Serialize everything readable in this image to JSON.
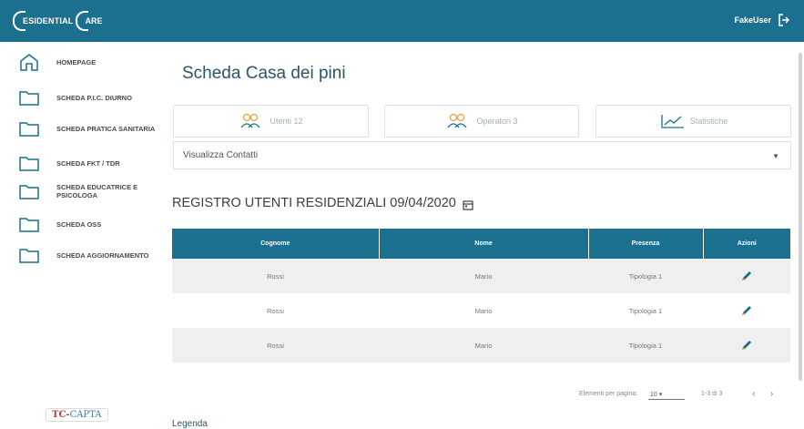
{
  "header": {
    "brand_part1": "ESIDENTIAL",
    "brand_part2": "ARE",
    "user": "FakeUser"
  },
  "sidebar": {
    "items": [
      {
        "label": "HOMEPAGE",
        "icon": "home-icon"
      },
      {
        "label": "SCHEDA P.I.C. DIURNO",
        "icon": "folder-icon"
      },
      {
        "label": "SCHEDA PRATICA SANITARIA",
        "icon": "folder-icon"
      },
      {
        "label": "SCHEDA FKT / TDR",
        "icon": "folder-icon"
      },
      {
        "label": "SCHEDA EDUCATRICE E PSICOLOGA",
        "icon": "folder-icon"
      },
      {
        "label": "SCHEDA OSS",
        "icon": "folder-icon"
      },
      {
        "label": "SCHEDA AGGIORNAMENTO",
        "icon": "folder-icon"
      }
    ],
    "logo_text_a": "TC-",
    "logo_text_b": "CAPTA"
  },
  "main": {
    "title": "Scheda Casa dei pini",
    "cards": [
      {
        "label": "Utenti 12",
        "icon": "users-icon"
      },
      {
        "label": "Operatori 3",
        "icon": "operators-icon"
      },
      {
        "label": "Statistiche",
        "icon": "chart-icon"
      }
    ],
    "contacts_label": "Visualizza Contatti",
    "register_title": "REGISTRO UTENTI RESIDENZIALI 09/04/2020"
  },
  "table": {
    "headers": [
      "Cognome",
      "Nome",
      "Presenza",
      "Azioni"
    ],
    "rows": [
      [
        "Rossi",
        "Mario",
        "Tipologia 1"
      ],
      [
        "Rossi",
        "Mario",
        "Tipologia 1"
      ],
      [
        "Rossi",
        "Mario",
        "Tipologia 1"
      ]
    ]
  },
  "pager": {
    "items_per_page_label": "Elementi per pagina:",
    "items_per_page_value": "10",
    "range": "1-3 di 3",
    "prev": "‹",
    "next": "›"
  },
  "legend": "Legenda",
  "colors": {
    "header_bg": "#1b6f8f",
    "accent_orange": "#e5a43a",
    "icon_blue": "#1b6f8f"
  }
}
